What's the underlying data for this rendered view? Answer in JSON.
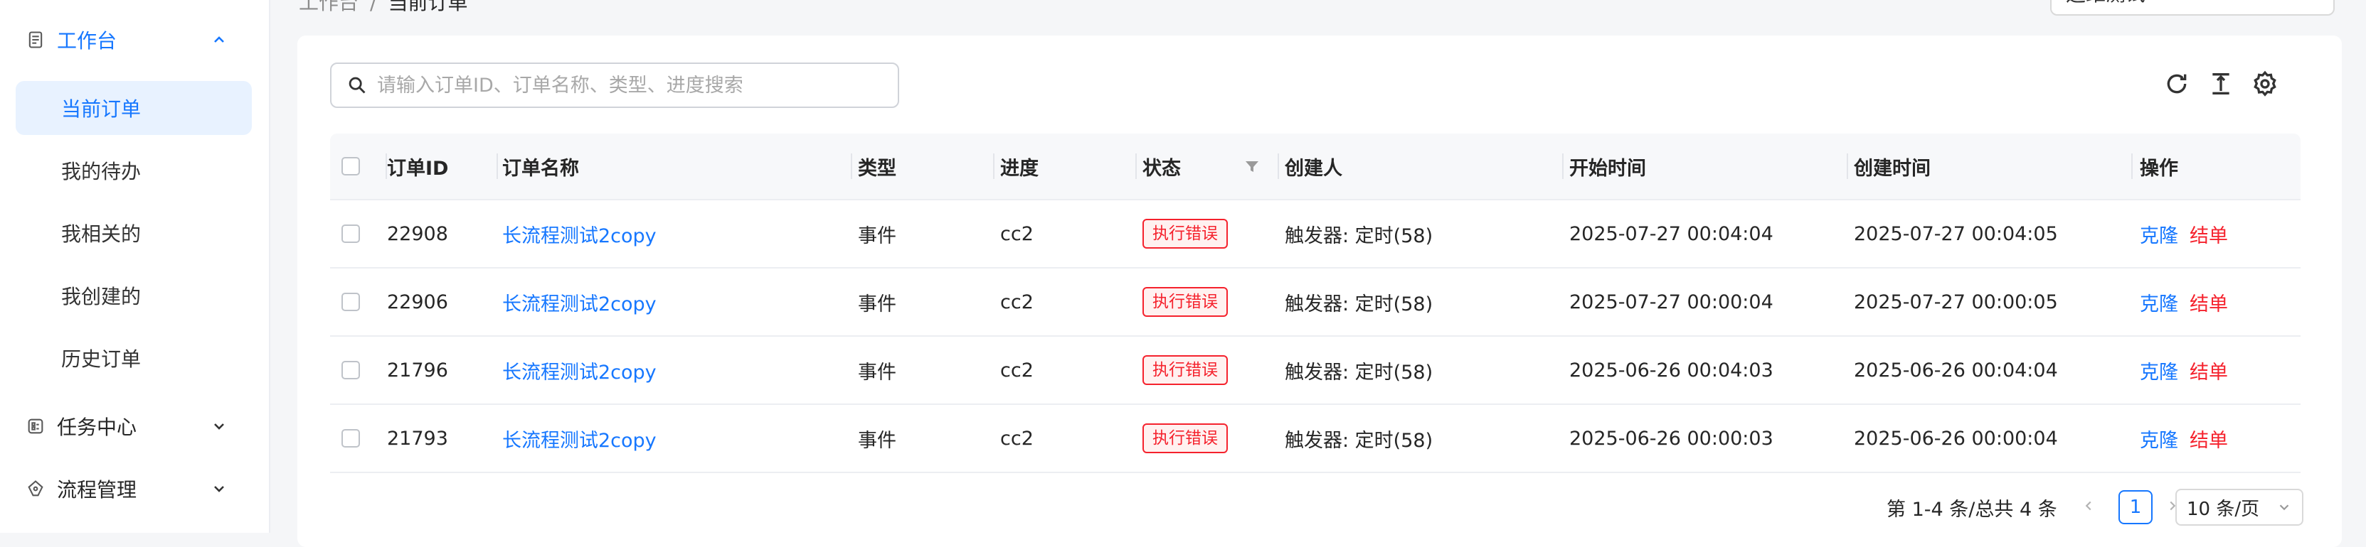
{
  "breadcrumb": {
    "root": "工作台",
    "sep": "/",
    "current": "当前订单"
  },
  "top_select": {
    "value": "运维测试"
  },
  "sidebar": {
    "workbench": {
      "label": "工作台"
    },
    "items": [
      {
        "label": "当前订单"
      },
      {
        "label": "我的待办"
      },
      {
        "label": "我相关的"
      },
      {
        "label": "我创建的"
      },
      {
        "label": "历史订单"
      }
    ],
    "task_center": {
      "label": "任务中心"
    },
    "flow_mgmt": {
      "label": "流程管理"
    }
  },
  "search": {
    "placeholder": "请输入订单ID、订单名称、类型、进度搜索",
    "value": ""
  },
  "toolbar": {
    "refresh_icon": "refresh-icon",
    "density_icon": "column-height-icon",
    "settings_icon": "gear-icon"
  },
  "table": {
    "headers": {
      "id": "订单ID",
      "name": "订单名称",
      "type": "类型",
      "progress": "进度",
      "status": "状态",
      "creator": "创建人",
      "start": "开始时间",
      "created": "创建时间",
      "ops": "操作"
    },
    "rows": [
      {
        "id": "22908",
        "name": "长流程测试2copy",
        "type": "事件",
        "progress": "cc2",
        "status": "执行错误",
        "creator": "触发器: 定时(58)",
        "start": "2025-07-27 00:04:04",
        "created": "2025-07-27 00:04:05",
        "op1": "克隆",
        "op2": "结单"
      },
      {
        "id": "22906",
        "name": "长流程测试2copy",
        "type": "事件",
        "progress": "cc2",
        "status": "执行错误",
        "creator": "触发器: 定时(58)",
        "start": "2025-07-27 00:00:04",
        "created": "2025-07-27 00:00:05",
        "op1": "克隆",
        "op2": "结单"
      },
      {
        "id": "21796",
        "name": "长流程测试2copy",
        "type": "事件",
        "progress": "cc2",
        "status": "执行错误",
        "creator": "触发器: 定时(58)",
        "start": "2025-06-26 00:04:03",
        "created": "2025-06-26 00:04:04",
        "op1": "克隆",
        "op2": "结单"
      },
      {
        "id": "21793",
        "name": "长流程测试2copy",
        "type": "事件",
        "progress": "cc2",
        "status": "执行错误",
        "creator": "触发器: 定时(58)",
        "start": "2025-06-26 00:00:03",
        "created": "2025-06-26 00:00:04",
        "op1": "克隆",
        "op2": "结单"
      }
    ]
  },
  "pagination": {
    "summary": "第 1-4 条/总共 4 条",
    "current": "1",
    "page_size": "10 条/页"
  },
  "colors": {
    "primary": "#1677ff",
    "danger": "#f5222d",
    "selected_bg": "#e8f2ff"
  }
}
